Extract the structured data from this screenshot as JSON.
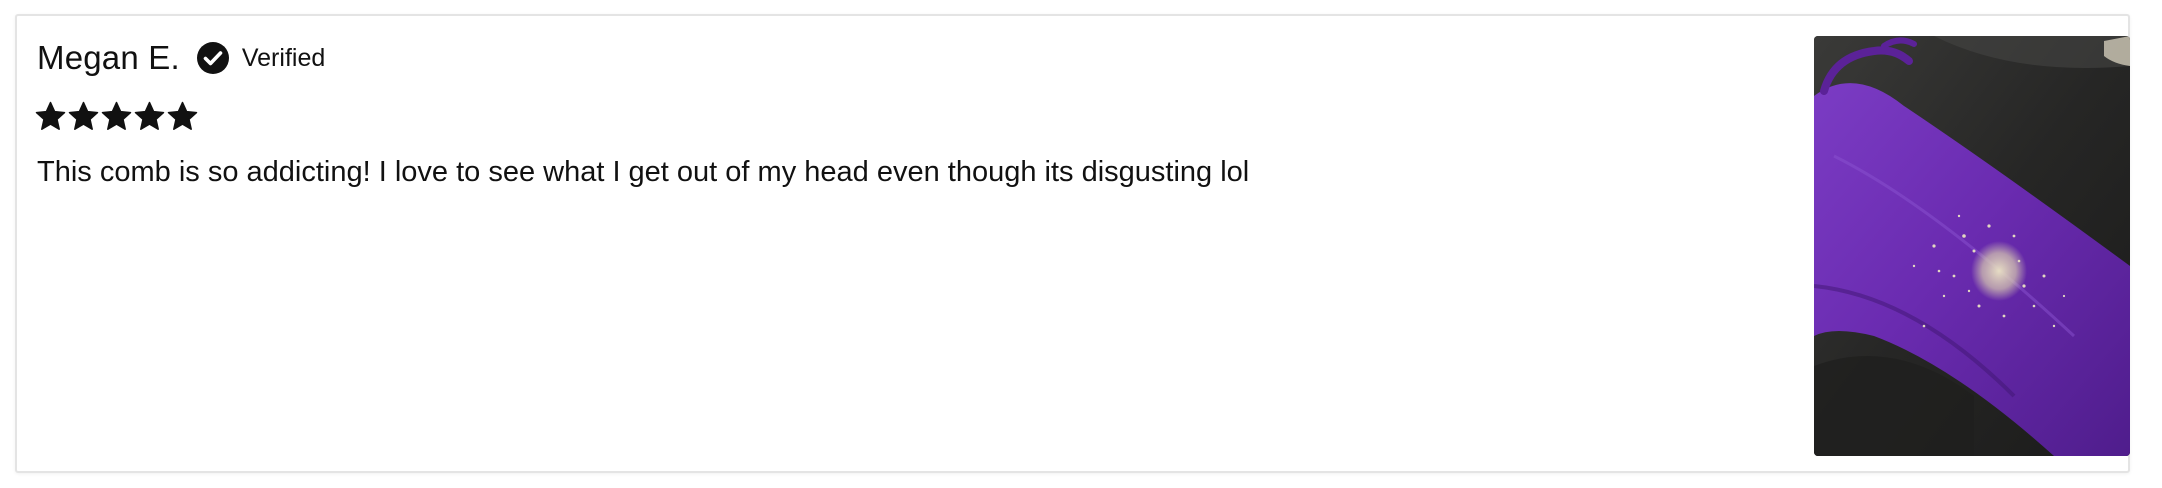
{
  "review": {
    "reviewer_name": "Megan E.",
    "verified_label": "Verified",
    "rating": 5,
    "rating_max": 5,
    "body": "This comb is so addicting! I love to see what I get out of my head even though its disgusting lol",
    "photo": {
      "icon": "review-photo"
    }
  },
  "colors": {
    "text": "#111111",
    "verified_badge": "#111111",
    "star": "#111111",
    "card_border": "#e4e4e4",
    "photo_purple": "#6a2bb0",
    "photo_dark": "#2b2b2b"
  }
}
